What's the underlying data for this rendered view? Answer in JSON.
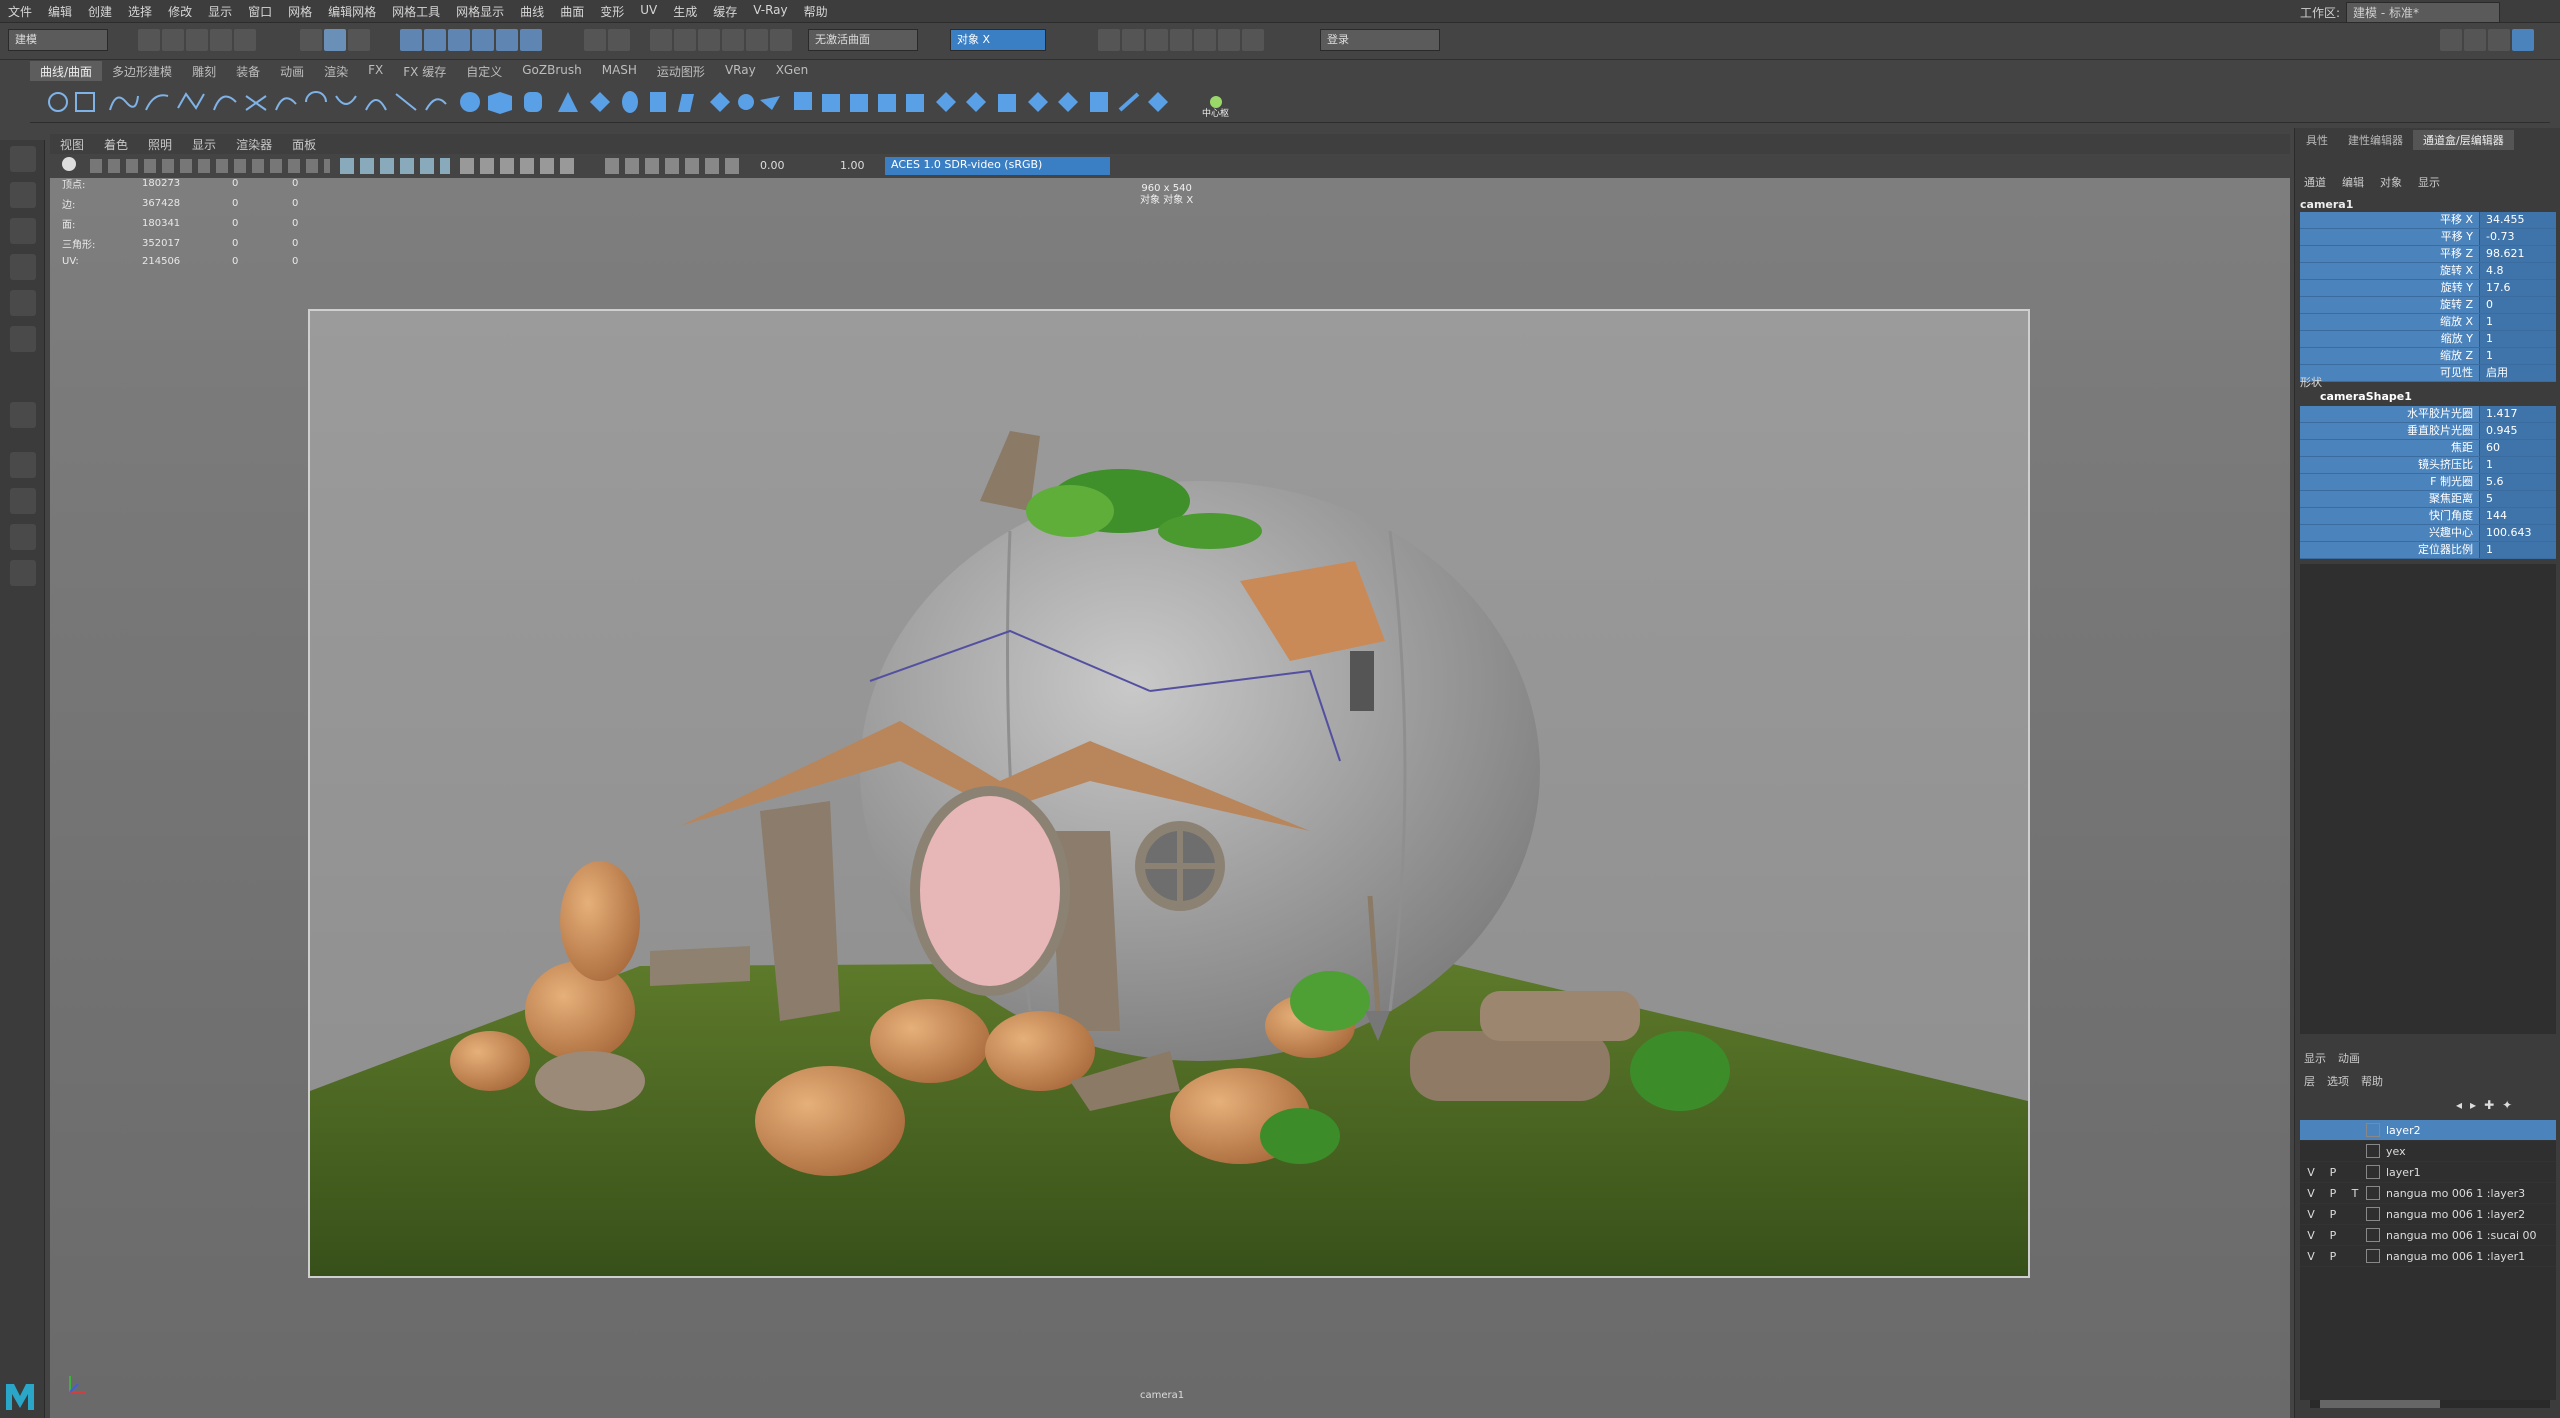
{
  "menubar": {
    "items": [
      "文件",
      "编辑",
      "创建",
      "选择",
      "修改",
      "显示",
      "窗口",
      "网格",
      "编辑网格",
      "网格工具",
      "网格显示",
      "曲线",
      "曲面",
      "变形",
      "UV",
      "生成",
      "缓存",
      "V-Ray",
      "帮助"
    ],
    "workspace_label": "工作区:",
    "workspace_value": "建模 - 标准*"
  },
  "statusline": {
    "mode_menu": "建模",
    "live_surface": "无激活曲面",
    "symmetry": "对象 X",
    "login": "登录"
  },
  "shelf": {
    "tabs": [
      "曲线/曲面",
      "多边形建模",
      "雕刻",
      "装备",
      "动画",
      "渲染",
      "FX",
      "FX 缓存",
      "自定义",
      "GoZBrush",
      "MASH",
      "运动图形",
      "VRay",
      "XGen"
    ],
    "center_pivot_label": "中心枢"
  },
  "panel": {
    "menu": [
      "视图",
      "着色",
      "照明",
      "显示",
      "渲染器",
      "面板"
    ],
    "exposure": "0.00",
    "gamma": "1.00",
    "color_space": "ACES 1.0 SDR-video (sRGB)"
  },
  "hud": {
    "rows": [
      {
        "name": "顶点:",
        "value": "180273",
        "sel": "0",
        "tri": "0"
      },
      {
        "name": "边:",
        "value": "367428",
        "sel": "0",
        "tri": "0"
      },
      {
        "name": "面:",
        "value": "180341",
        "sel": "0",
        "tri": "0"
      },
      {
        "name": "三角形:",
        "value": "352017",
        "sel": "0",
        "tri": "0"
      },
      {
        "name": "UV:",
        "value": "214506",
        "sel": "0",
        "tri": "0"
      }
    ],
    "resolution": "960 x 540",
    "resolution_sub": "对象 对象 X",
    "camera_name": "camera1"
  },
  "channel_box": {
    "tabs": [
      "具性",
      "建性编辑器",
      "通道盒/层编辑器"
    ],
    "menu": [
      "通道",
      "编辑",
      "对象",
      "显示"
    ],
    "object_name": "camera1",
    "transform": [
      {
        "label": "平移 X",
        "value": "34.455"
      },
      {
        "label": "平移 Y",
        "value": "-0.73"
      },
      {
        "label": "平移 Z",
        "value": "98.621"
      },
      {
        "label": "旋转 X",
        "value": "4.8"
      },
      {
        "label": "旋转 Y",
        "value": "17.6"
      },
      {
        "label": "旋转 Z",
        "value": "0"
      },
      {
        "label": "缩放 X",
        "value": "1"
      },
      {
        "label": "缩放 Y",
        "value": "1"
      },
      {
        "label": "缩放 Z",
        "value": "1"
      },
      {
        "label": "可见性",
        "value": "启用"
      }
    ],
    "shapes_header": "形状",
    "shape_name": "cameraShape1",
    "shape_attrs": [
      {
        "label": "水平胶片光圈",
        "value": "1.417"
      },
      {
        "label": "垂直胶片光圈",
        "value": "0.945"
      },
      {
        "label": "焦距",
        "value": "60"
      },
      {
        "label": "镜头挤压比",
        "value": "1"
      },
      {
        "label": "F 制光圈",
        "value": "5.6"
      },
      {
        "label": "聚焦距离",
        "value": "5"
      },
      {
        "label": "快门角度",
        "value": "144"
      },
      {
        "label": "兴趣中心",
        "value": "100.643"
      },
      {
        "label": "定位器比例",
        "value": "1"
      }
    ]
  },
  "layer_editor": {
    "tabs": [
      "显示",
      "动画"
    ],
    "menu": [
      "层",
      "选项",
      "帮助"
    ],
    "layers": [
      {
        "v": "",
        "p": "",
        "t": "",
        "name": "layer2",
        "selected": true
      },
      {
        "v": "",
        "p": "",
        "t": "",
        "name": "yex",
        "selected": false
      },
      {
        "v": "V",
        "p": "P",
        "t": "",
        "name": "layer1",
        "selected": false
      },
      {
        "v": "V",
        "p": "P",
        "t": "T",
        "name": "nangua mo 006 1 :layer3",
        "selected": false
      },
      {
        "v": "V",
        "p": "P",
        "t": "",
        "name": "nangua mo 006 1 :layer2",
        "selected": false
      },
      {
        "v": "V",
        "p": "P",
        "t": "",
        "name": "nangua mo 006 1 :sucai 00",
        "selected": false
      },
      {
        "v": "V",
        "p": "P",
        "t": "",
        "name": "nangua mo 006 1 :layer1",
        "selected": false
      }
    ]
  },
  "colors": {
    "accent": "#4b83bd",
    "ui_bg": "#444444",
    "viewport_bg": "#7e7e7e"
  }
}
